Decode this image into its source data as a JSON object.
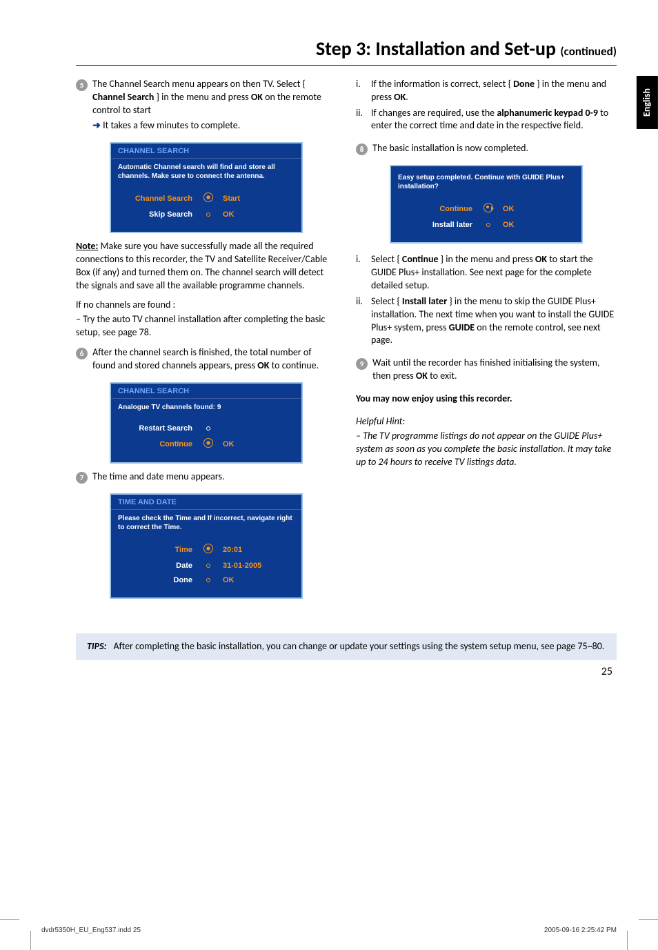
{
  "title_main": "Step 3: Installation and Set-up ",
  "title_cont": "(continued)",
  "lang_tab": "English",
  "left": {
    "step5": {
      "num": "5",
      "text1": "The Channel Search menu appears on then TV. Select { ",
      "bold1": "Channel Search",
      "text2": " } in the menu and press ",
      "bold2": "OK",
      "text3": " on the remote control to start",
      "bullet_arrow": "➜",
      "bullet_text": " It takes a few minutes to complete."
    },
    "box1": {
      "header": "CHANNEL SEARCH",
      "sub": "Automatic Channel search will find and store all channels. Make sure to connect the antenna.",
      "row1_label": "Channel Search",
      "row1_val": "Start",
      "row2_label": "Skip Search",
      "row2_val": "OK"
    },
    "note_label": "Note:",
    "note_body": " Make sure you have successfully made all the required connections to this recorder, the TV and Satellite Receiver/Cable Box (if any) and turned them on. The channel search will detect the signals and save all the available programme channels.",
    "nochan1": "If no channels are found :",
    "nochan2": "– Try the auto TV channel installation after completing the basic setup, see page 78.",
    "step6": {
      "num": "6",
      "text1": "After the channel search is finished, the total number of found and stored channels appears, press ",
      "bold1": "OK",
      "text2": " to continue."
    },
    "box2": {
      "header": "CHANNEL SEARCH",
      "sub": "Analogue TV channels found: 9",
      "row1_label": "Restart Search",
      "row2_label": "Continue",
      "row2_val": "OK"
    },
    "step7": {
      "num": "7",
      "text": "The time and date menu appears."
    },
    "box3": {
      "header": "TIME AND DATE",
      "sub": "Please check the Time and If incorrect, navigate right to correct the Time.",
      "row1_label": "Time",
      "row1_val": "20:01",
      "row2_label": "Date",
      "row2_val": "31-01-2005",
      "row3_label": "Done",
      "row3_val": "OK"
    }
  },
  "right": {
    "i": {
      "rn": "i.",
      "t1": "If the information is correct, select { ",
      "b1": "Done",
      "t2": " } in the menu and press ",
      "b2": "OK",
      "t3": "."
    },
    "ii": {
      "rn": "ii.",
      "t1": "If changes are required, use the ",
      "b1": "alphanumeric keypad 0-9",
      "t2": " to enter the correct time and date in the respective field."
    },
    "step8": {
      "num": "8",
      "text": "The basic installation is now completed."
    },
    "box4": {
      "sub": "Easy setup completed.  Continue with GUIDE Plus+ installation?",
      "row1_label": "Continue",
      "row1_val": "OK",
      "row2_label": "Install later",
      "row2_val": "OK"
    },
    "i2": {
      "rn": "i.",
      "t1": "Select { ",
      "b1": "Continue",
      "t2": " } in the menu and press ",
      "b2": "OK",
      "t3": " to start the GUIDE Plus+ installation. See next page for the complete detailed setup."
    },
    "ii2": {
      "rn": "ii.",
      "t1": "Select { ",
      "b1": "Install later",
      "t2": " } in the menu to skip the GUIDE Plus+ installation. The next time when you want to install the GUIDE Plus+ system, press ",
      "b2": "GUIDE",
      "t3": " on the remote control, see next page."
    },
    "step9": {
      "num": "9",
      "t1": "Wait until the recorder has finished initialising the system, then press ",
      "b1": "OK",
      "t2": " to exit."
    },
    "enjoy": "You may now enjoy using this recorder.",
    "hint_label": "Helpful Hint:",
    "hint_body": "– The TV programme listings do not appear on the GUIDE Plus+ system as soon as you complete the basic installation. It may take up to 24 hours to receive TV listings data."
  },
  "tips_label": "TIPS:",
  "tips_body": "After completing the basic installation, you can change or update your settings using the system setup menu, see page 75~80.",
  "page_num": "25",
  "footer_left": "dvdr5350H_EU_Eng537.indd   25",
  "footer_right": "2005-09-16   2:25:42 PM"
}
